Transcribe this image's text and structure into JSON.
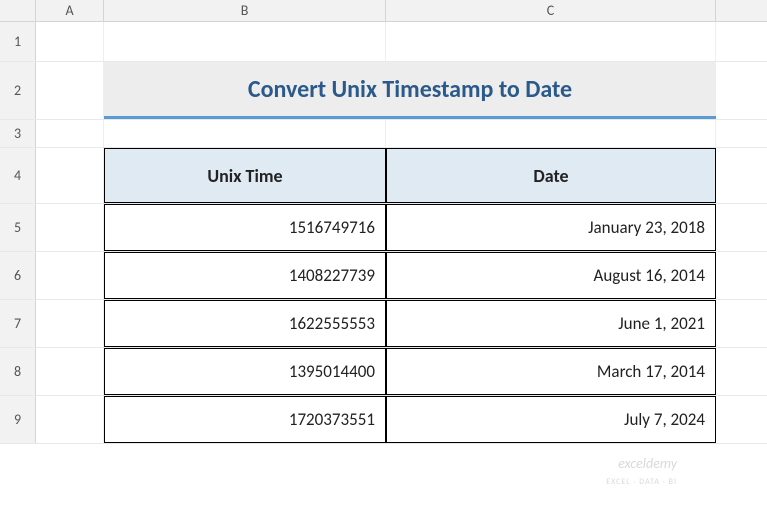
{
  "columns": {
    "A": "A",
    "B": "B",
    "C": "C"
  },
  "rows": {
    "r1": "1",
    "r2": "2",
    "r3": "3",
    "r4": "4",
    "r5": "5",
    "r6": "6",
    "r7": "7",
    "r8": "8",
    "r9": "9"
  },
  "title": "Convert Unix Timestamp to Date",
  "headers": {
    "unix": "Unix Time",
    "date": "Date"
  },
  "data": [
    {
      "unix": "1516749716",
      "date": "January 23, 2018"
    },
    {
      "unix": "1408227739",
      "date": "August 16, 2014"
    },
    {
      "unix": "1622555553",
      "date": "June 1, 2021"
    },
    {
      "unix": "1395014400",
      "date": "March 17, 2014"
    },
    {
      "unix": "1720373551",
      "date": "July 7, 2024"
    }
  ],
  "watermark": {
    "brand": "exceldemy",
    "tag": "EXCEL · DATA · BI"
  }
}
